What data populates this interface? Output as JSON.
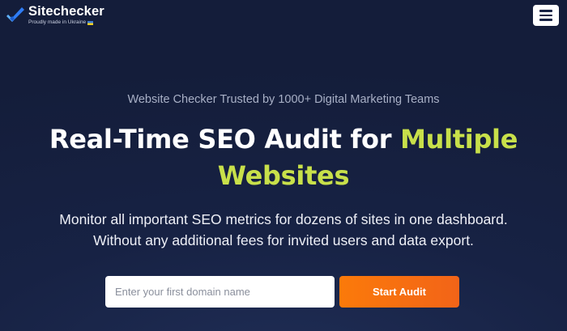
{
  "brand": {
    "name": "Sitechecker",
    "subtitle": "Proudly made in Ukraine",
    "logo_icon": "checkmark-logo-icon",
    "flag_icon": "ukraine-flag-icon"
  },
  "header": {
    "menu_icon": "hamburger-menu-icon"
  },
  "hero": {
    "tagline": "Website Checker Trusted by 1000+ Digital Marketing Teams",
    "headline_part1": "Real-Time SEO Audit for ",
    "headline_accent": "Multiple Websites",
    "description_line1": "Monitor all important SEO metrics for dozens of sites in one dashboard.",
    "description_line2": "Without any additional fees for invited users and data export."
  },
  "form": {
    "domain_placeholder": "Enter your first domain name",
    "domain_value": "",
    "submit_label": "Start Audit"
  },
  "colors": {
    "background": "#172244",
    "accent": "#c8e04a",
    "button": "#f26418"
  }
}
